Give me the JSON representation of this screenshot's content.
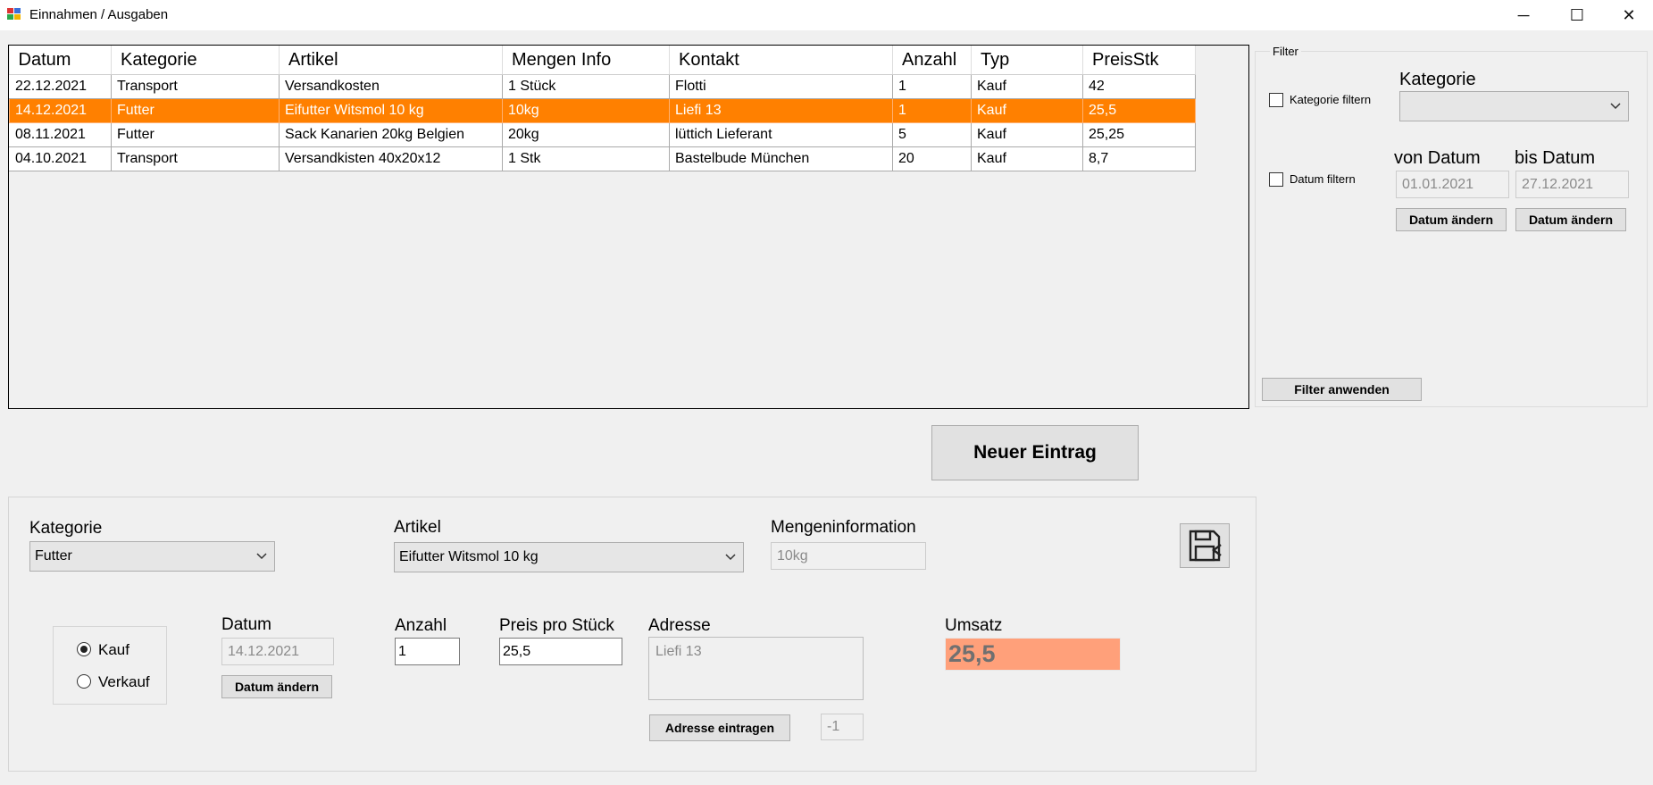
{
  "window": {
    "title": "Einnahmen / Ausgaben",
    "minimize_glyph": "─",
    "maximize_glyph": "☐",
    "close_glyph": "✕"
  },
  "grid": {
    "columns": [
      "Datum",
      "Kategorie",
      "Artikel",
      "Mengen Info",
      "Kontakt",
      "Anzahl",
      "Typ",
      "PreisStk"
    ],
    "rows": [
      [
        "22.12.2021",
        "Transport",
        "Versandkosten",
        "1 Stück",
        "Flotti",
        "1",
        "Kauf",
        "42"
      ],
      [
        "14.12.2021",
        "Futter",
        "Eifutter Witsmol 10 kg",
        "10kg",
        "Liefi 13",
        "1",
        "Kauf",
        "25,5"
      ],
      [
        "08.11.2021",
        "Futter",
        "Sack Kanarien 20kg Belgien",
        "20kg",
        "lüttich Lieferant",
        "5",
        "Kauf",
        "25,25"
      ],
      [
        "04.10.2021",
        "Transport",
        "Versandkisten 40x20x12",
        "1 Stk",
        "Bastelbude München",
        "20",
        "Kauf",
        "8,7"
      ]
    ],
    "selected_row": 1
  },
  "filter": {
    "legend": "Filter",
    "kategorie_checkbox_label": "Kategorie filtern",
    "kategorie_label": "Kategorie",
    "kategorie_value": "",
    "datum_checkbox_label": "Datum filtern",
    "von_label": "von Datum",
    "bis_label": "bis Datum",
    "von_value": "01.01.2021",
    "bis_value": "27.12.2021",
    "change_date_label": "Datum ändern",
    "apply_label": "Filter anwenden"
  },
  "new_entry_label": "Neuer Eintrag",
  "form": {
    "kategorie_label": "Kategorie",
    "kategorie_value": "Futter",
    "artikel_label": "Artikel",
    "artikel_value": "Eifutter Witsmol 10 kg",
    "mengen_label": "Mengeninformation",
    "mengen_value": "10kg",
    "kauf_label": "Kauf",
    "verkauf_label": "Verkauf",
    "datum_label": "Datum",
    "datum_value": "14.12.2021",
    "datum_button": "Datum ändern",
    "anzahl_label": "Anzahl",
    "anzahl_value": "1",
    "preis_label": "Preis pro Stück",
    "preis_value": "25,5",
    "adresse_label": "Adresse",
    "adresse_value": "Liefi 13",
    "adresse_button": "Adresse eintragen",
    "id_value": "-1",
    "umsatz_label": "Umsatz",
    "umsatz_value": "25,5"
  },
  "colors": {
    "selection": "#ff8000",
    "umsatz_bg": "#ffa07a"
  }
}
